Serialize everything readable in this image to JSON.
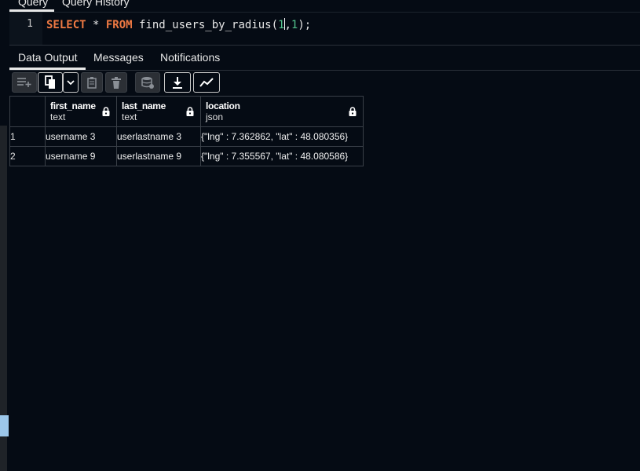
{
  "query_tabs": {
    "active": "Query",
    "other": "Query History"
  },
  "editor": {
    "line_number": "1",
    "tokens": {
      "select": "SELECT",
      "star": " * ",
      "from": "FROM",
      "fn": " find_users_by_radius(",
      "arg1": "1",
      "comma": ",",
      "arg2": "1",
      "end": ");"
    }
  },
  "result_tabs": {
    "data_output": "Data Output",
    "messages": "Messages",
    "notifications": "Notifications"
  },
  "toolbar_icons": [
    "add-row-icon",
    "copy-icon",
    "chevron-down-icon",
    "paste-icon",
    "delete-icon",
    "save-data-icon",
    "download-icon",
    "graph-icon"
  ],
  "table": {
    "columns": [
      {
        "name": "first_name",
        "type": "text"
      },
      {
        "name": "last_name",
        "type": "text"
      },
      {
        "name": "location",
        "type": "json"
      }
    ],
    "rows": [
      {
        "num": "1",
        "cells": [
          "username 3",
          "userlastname 3",
          "{\"lng\" : 7.362862, \"lat\" : 48.080356}"
        ]
      },
      {
        "num": "2",
        "cells": [
          "username 9",
          "userlastname 9",
          "{\"lng\" : 7.355567, \"lat\" : 48.080586}"
        ]
      }
    ]
  },
  "colors": {
    "background": "#050b14",
    "keyword": "#f07a43",
    "number": "#52c28c",
    "scrollbar_thumb": "#9cc7ea"
  }
}
